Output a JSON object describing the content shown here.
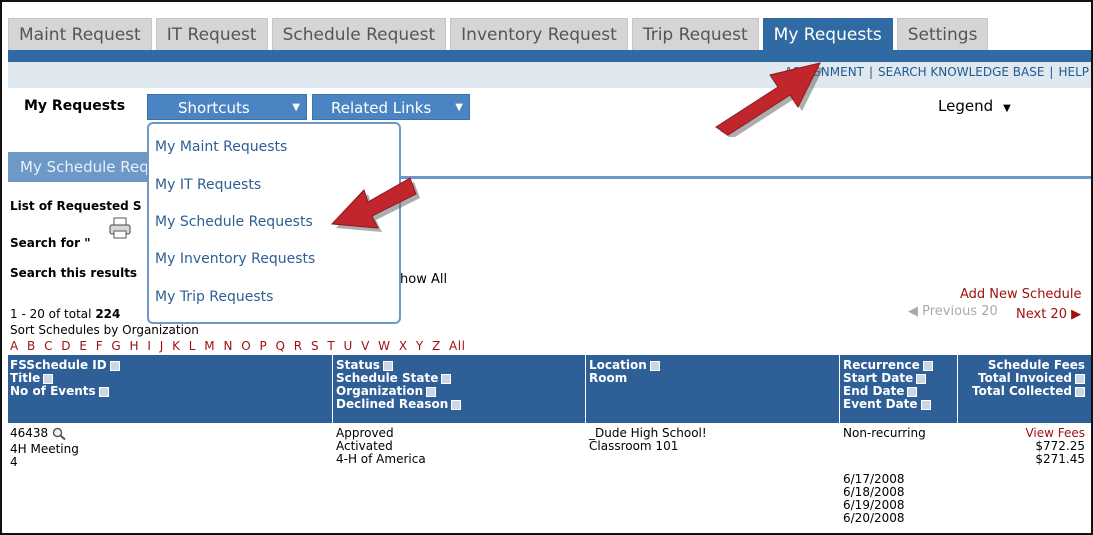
{
  "tabs": [
    "Maint Request",
    "IT Request",
    "Schedule Request",
    "Inventory Request",
    "Trip Request",
    "My Requests",
    "Settings"
  ],
  "top_links": {
    "assignment": "ASSIGNMENT",
    "search_kb": "SEARCH KNOWLEDGE BASE",
    "help": "HELP"
  },
  "toolbar": {
    "title": "My Requests",
    "shortcuts": "Shortcuts",
    "related_links": "Related Links",
    "legend": "Legend"
  },
  "shortcuts_menu": [
    "My Maint Requests",
    "My IT Requests",
    "My Schedule Requests",
    "My Inventory Requests",
    "My Trip Requests"
  ],
  "section_tab": "My Schedule Requests",
  "list_label": "List of Requested S",
  "search_for": "Search for \"",
  "search_results": "Search this results",
  "show_all": "how All",
  "add_new": "Add New Schedule",
  "prev": "Previous 20",
  "next": "Next 20",
  "total_prefix": "1 - 20 of total",
  "total_count": "224",
  "sort_by": "Sort Schedules by Organization",
  "alphabet": "A B C D E F G H I J K L M N O P Q R S T U V W X Y Z All",
  "table": {
    "headers": {
      "c1": [
        "FSSchedule ID",
        "Title",
        "No of Events"
      ],
      "c2": [
        "Status",
        "Schedule State",
        "Organization",
        "Declined Reason"
      ],
      "c3": [
        "Location",
        "Room"
      ],
      "c4": [
        "Recurrence",
        "Start Date",
        "End Date",
        "Event Date"
      ],
      "c5": [
        "Schedule Fees",
        "Total Invoiced",
        "Total Collected"
      ]
    },
    "row": {
      "id": "46438",
      "title": "4H Meeting",
      "events": "4",
      "status": "Approved",
      "state": "Activated",
      "organization": "4-H of America",
      "location": "_Dude High School!",
      "room": "Classroom 101",
      "recurrence": "Non-recurring",
      "dates": [
        "6/17/2008",
        "6/18/2008",
        "6/19/2008",
        "6/20/2008"
      ],
      "view_fees": "View Fees",
      "invoiced": "$772.25",
      "collected": "$271.45"
    }
  },
  "colors": {
    "tab_active": "#2f6aa2",
    "header_blue": "#2f5f97",
    "link_red": "#a01010",
    "arrow_red": "#c0262c"
  }
}
